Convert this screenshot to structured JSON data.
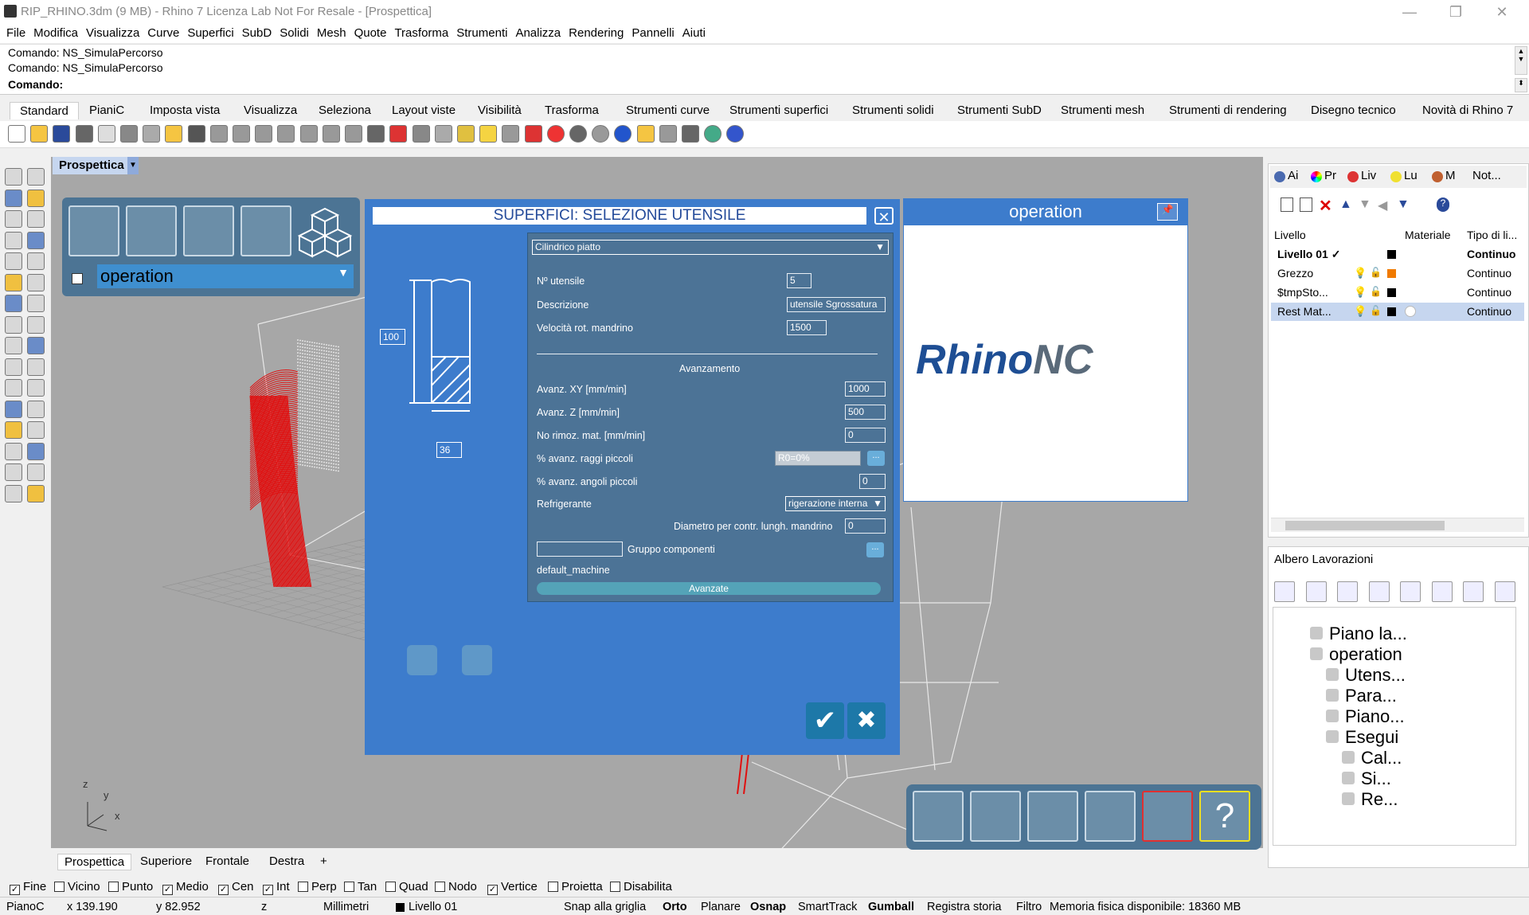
{
  "window": {
    "title": "RIP_RHINO.3dm (9 MB) - Rhino 7 Licenza Lab Not For Resale - [Prospettica]",
    "minimize": "—",
    "restore": "❐",
    "close": "✕"
  },
  "menu": [
    "File",
    "Modifica",
    "Visualizza",
    "Curve",
    "Superfici",
    "SubD",
    "Solidi",
    "Mesh",
    "Quote",
    "Trasforma",
    "Strumenti",
    "Analizza",
    "Rendering",
    "Pannelli",
    "Aiuti"
  ],
  "command": {
    "history": [
      "Comando: NS_SimulaPercorso",
      "Comando: NS_SimulaPercorso"
    ],
    "prompt": "Comando:"
  },
  "toolbar_tabs": [
    "Standard",
    "PianiC",
    "Imposta vista",
    "Visualizza",
    "Seleziona",
    "Layout viste",
    "Visibilità",
    "Trasforma",
    "Strumenti curve",
    "Strumenti superfici",
    "Strumenti solidi",
    "Strumenti SubD",
    "Strumenti mesh",
    "Strumenti di rendering",
    "Disegno tecnico",
    "Novità di Rhino 7"
  ],
  "viewport": {
    "name": "Prospettica",
    "tabs": [
      "Prospettica",
      "Superiore",
      "Frontale",
      "Destra"
    ],
    "add_tab": "+",
    "axes": {
      "z": "z",
      "y": "y",
      "x": "x"
    }
  },
  "ops_panel": {
    "selected_operation": "operation"
  },
  "dialog": {
    "title": "SUPERFICI: SELEZIONE UTENSILE",
    "close": "✕",
    "tool_type": "Cilindrico piatto",
    "tool_length": "100",
    "tool_diameter": "36",
    "fields": {
      "n_utensile_label": "Nº utensile",
      "n_utensile_value": "5",
      "descrizione_label": "Descrizione",
      "descrizione_value": "utensile Sgrossatura",
      "velocita_label": "Velocità rot. mandrino",
      "velocita_value": "1500",
      "avanzamento_title": "Avanzamento",
      "avanz_xy_label": "Avanz. XY [mm/min]",
      "avanz_xy_value": "1000",
      "avanz_z_label": "Avanz. Z [mm/min]",
      "avanz_z_value": "500",
      "no_rimoz_label": "No rimoz. mat. [mm/min]",
      "no_rimoz_value": "0",
      "raggi_label": "% avanz. raggi piccoli",
      "raggi_value": "R0=0%",
      "angoli_label": "% avanz. angoli piccoli",
      "angoli_value": "0",
      "refrigerante_label": "Refrigerante",
      "refrigerante_value": "rigerazione interna",
      "diametro_label": "Diametro per contr. lungh. mandrino",
      "diametro_value": "0",
      "gruppo_label": "Gruppo componenti",
      "gruppo_value": "",
      "machine": "default_machine",
      "dots": "...",
      "avanzate": "Avanzate"
    },
    "ok": "✔",
    "cancel": "✖"
  },
  "operation_panel": {
    "title": "operation",
    "logo_a": "Rhino",
    "logo_b": "NC"
  },
  "right_panel": {
    "tabs": [
      "Ai",
      "Pr",
      "Liv",
      "Lu",
      "M",
      "Not..."
    ],
    "columns": {
      "livello": "Livello",
      "materiale": "Materiale",
      "tipo": "Tipo di li..."
    },
    "layers": [
      {
        "name": "Livello 01 ✓",
        "type": "Continuo",
        "color": "#000000"
      },
      {
        "name": "Grezzo",
        "type": "Continuo",
        "color": "#f07a00"
      },
      {
        "name": "$tmpSto...",
        "type": "Continuo",
        "color": "#000000"
      },
      {
        "name": "Rest Mat...",
        "type": "Continuo",
        "color": "#000000"
      }
    ]
  },
  "albero": {
    "title": "Albero Lavorazioni",
    "nodes": [
      "Piano la...",
      "operation",
      "Utens...",
      "Para...",
      "Piano...",
      "Esegui",
      "Cal...",
      "Si...",
      "Re..."
    ]
  },
  "osnap": [
    {
      "label": "Fine",
      "checked": true
    },
    {
      "label": "Vicino",
      "checked": false
    },
    {
      "label": "Punto",
      "checked": false
    },
    {
      "label": "Medio",
      "checked": true
    },
    {
      "label": "Cen",
      "checked": true
    },
    {
      "label": "Int",
      "checked": true
    },
    {
      "label": "Perp",
      "checked": false
    },
    {
      "label": "Tan",
      "checked": false
    },
    {
      "label": "Quad",
      "checked": false
    },
    {
      "label": "Nodo",
      "checked": false
    },
    {
      "label": "Vertice",
      "checked": true
    },
    {
      "label": "Proietta",
      "checked": false
    },
    {
      "label": "Disabilita",
      "checked": false
    }
  ],
  "status": {
    "cplane": "PianoC",
    "x": "x 139.190",
    "y": "y 82.952",
    "z": "z",
    "units": "Millimetri",
    "layer": "Livello 01",
    "snap": "Snap alla griglia",
    "orto": "Orto",
    "planare": "Planare",
    "osnap": "Osnap",
    "smarttrack": "SmartTrack",
    "gumball": "Gumball",
    "registra": "Registra storia",
    "filtro": "Filtro",
    "memoria": "Memoria fisica disponibile: 18360 MB"
  },
  "colors": {
    "dialog_blue": "#3d7ccc",
    "panel_slate": "#4c7494",
    "toolpath_red": "#e01010",
    "viewport_bg": "#a7a7a7"
  }
}
